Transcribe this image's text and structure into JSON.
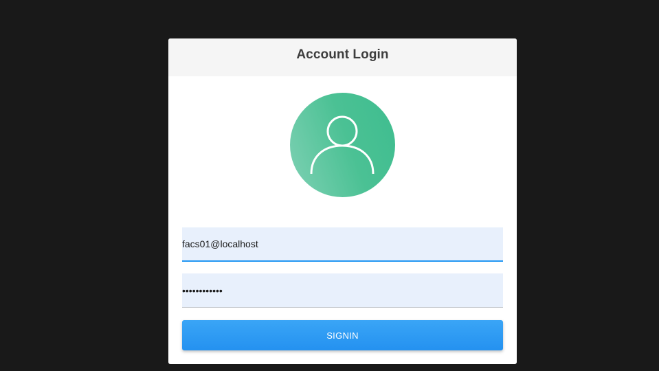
{
  "login": {
    "title": "Account Login",
    "avatar_icon": "user-icon",
    "email_value": "facs01@localhost",
    "password_value": "passwordmask",
    "signin_label": "SIGNIN"
  },
  "colors": {
    "background": "#191919",
    "card": "#ffffff",
    "header": "#f5f5f5",
    "avatar_green": "#4bc194",
    "input_fill": "#e8f0fc",
    "focus_underline": "#2196f3",
    "button": "#2491f0"
  }
}
